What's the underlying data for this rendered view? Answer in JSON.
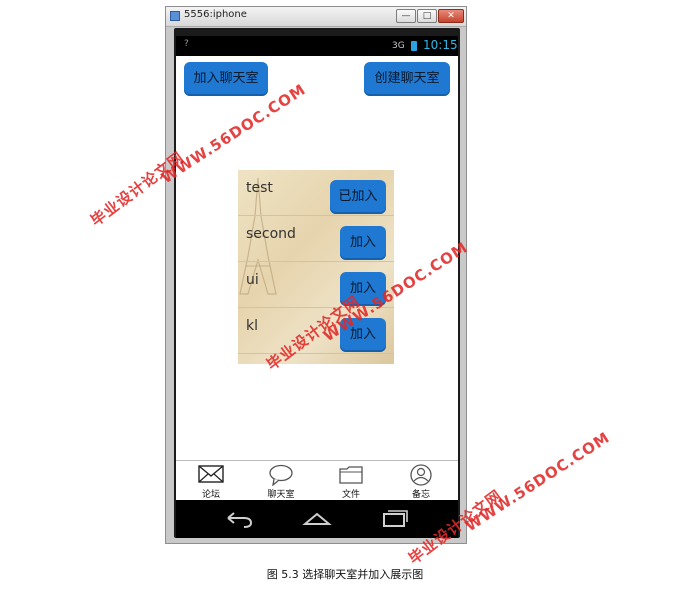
{
  "window": {
    "title": "5556:iphone",
    "min_glyph": "—",
    "max_glyph": "□",
    "close_glyph": "✕"
  },
  "status_bar": {
    "left_indicator": "?",
    "signal": "3G",
    "time": "10:15",
    "time_color": "#33b5e5"
  },
  "header": {
    "join_button": "加入聊天室",
    "create_button": "创建聊天室",
    "button_color": "#1f78d1"
  },
  "chatrooms": [
    {
      "name": "test",
      "action": "已加入"
    },
    {
      "name": "second",
      "action": "加入"
    },
    {
      "name": "ui",
      "action": "加入"
    },
    {
      "name": "kl",
      "action": "加入"
    },
    {
      "name": "",
      "action": ""
    }
  ],
  "tabs": [
    {
      "label": "论坛",
      "icon": "mail-icon"
    },
    {
      "label": "聊天室",
      "icon": "speech-bubble-icon"
    },
    {
      "label": "文件",
      "icon": "folder-icon"
    },
    {
      "label": "备忘",
      "icon": "user-circle-icon"
    }
  ],
  "navigation": {
    "back_icon": "back-arrow-icon",
    "home_icon": "home-icon",
    "recent_icon": "recent-apps-icon"
  },
  "watermark": {
    "cn": "毕业设计论文网",
    "url": "WWW.56DOC.COM"
  },
  "caption": "图 5.3 选择聊天室并加入展示图"
}
